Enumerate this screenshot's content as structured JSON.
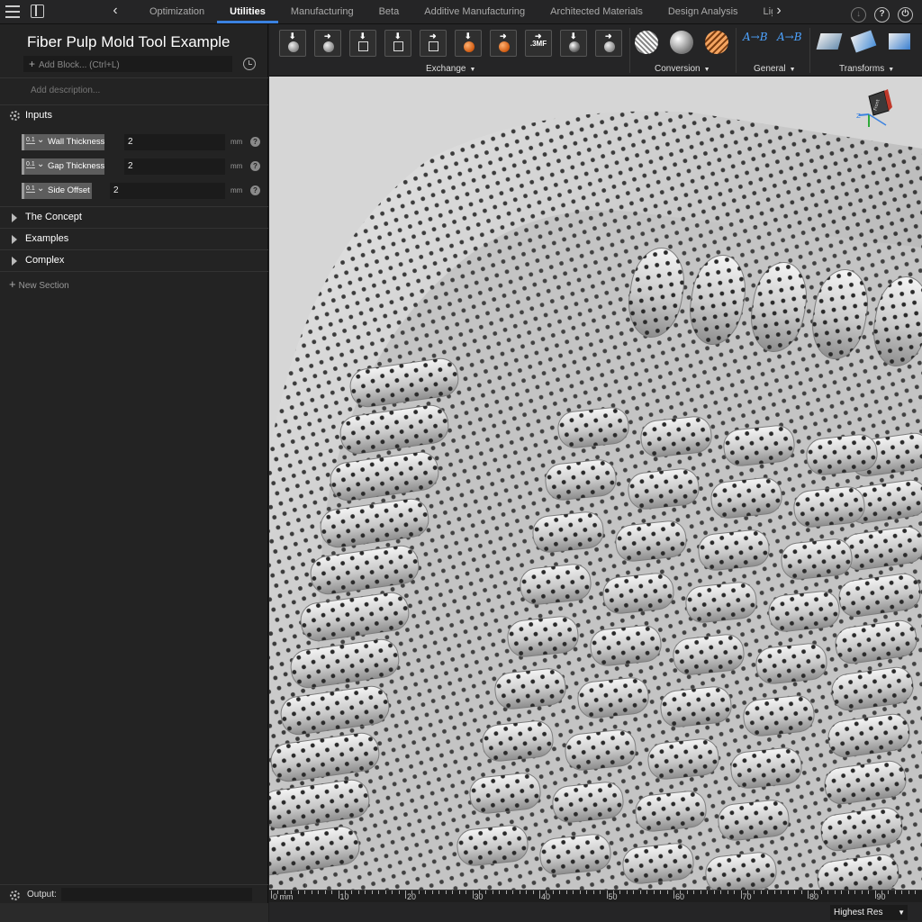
{
  "topbar": {
    "tabs": [
      {
        "label": "Optimization",
        "active": false
      },
      {
        "label": "Utilities",
        "active": true
      },
      {
        "label": "Manufacturing",
        "active": false
      },
      {
        "label": "Beta",
        "active": false
      },
      {
        "label": "Additive Manufacturing",
        "active": false
      },
      {
        "label": "Architected Materials",
        "active": false
      },
      {
        "label": "Design Analysis",
        "active": false
      },
      {
        "label": "Lightweighting",
        "active": false
      }
    ],
    "help_label": "?",
    "accent": "#3b82e0"
  },
  "sidebar": {
    "title": "Fiber Pulp Mold Tool Example",
    "add_block_placeholder": "Add Block... (Ctrl+L)",
    "description_placeholder": "Add description...",
    "inputs_section": "Inputs",
    "inputs": [
      {
        "type_tag": "0.1",
        "name": "Wall Thickness",
        "value": "2",
        "unit": "mm"
      },
      {
        "type_tag": "0.1",
        "name": "Gap Thickness",
        "value": "2",
        "unit": "mm"
      },
      {
        "type_tag": "0.1",
        "name": "Side Offset",
        "value": "2",
        "unit": "mm"
      }
    ],
    "sections": [
      "The Concept",
      "Examples",
      "Complex"
    ],
    "new_section": "New Section",
    "output_label": "Output:"
  },
  "toolbar": {
    "groups": [
      "Exchange",
      "Conversion",
      "General",
      "Transforms"
    ],
    "mf_label": ".3MF",
    "general_left_text": "A→B",
    "general_right_text": "A→B"
  },
  "viewport": {
    "nav_cube_face": "Front",
    "ruler_unit": "mm",
    "ruler_labels": [
      "0 mm",
      "10",
      "20",
      "30",
      "40",
      "50",
      "60",
      "70",
      "80",
      "90"
    ],
    "resolution": "Highest Res"
  }
}
